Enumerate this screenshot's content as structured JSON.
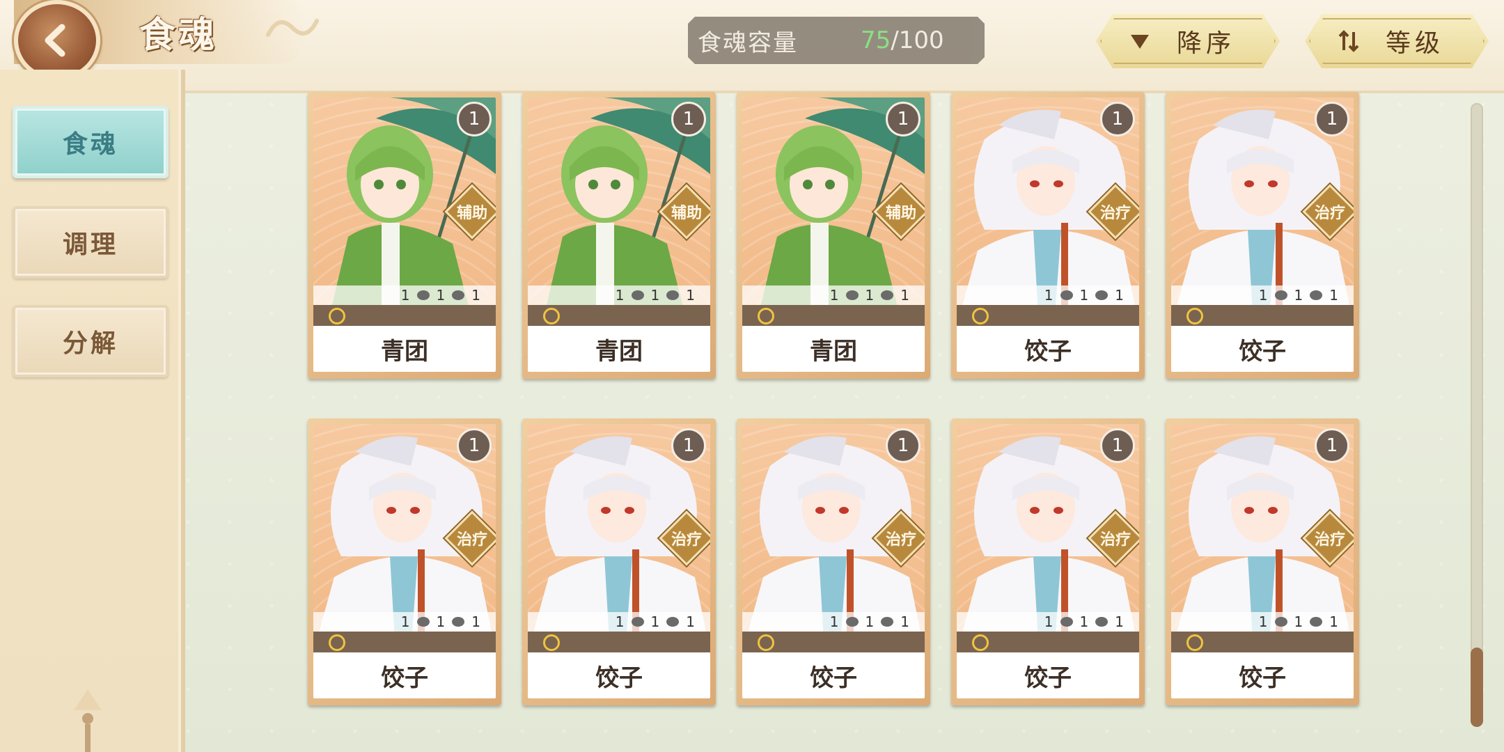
{
  "header": {
    "title": "食魂",
    "capacity_label": "食魂容量",
    "capacity_count": "75",
    "capacity_max": "/100",
    "sort_order_label": "降序",
    "sort_key_label": "等级"
  },
  "sidebar": {
    "items": [
      {
        "label": "食魂",
        "active": true
      },
      {
        "label": "调理",
        "active": false
      },
      {
        "label": "分解",
        "active": false
      }
    ]
  },
  "cards": [
    {
      "name": "青团",
      "level": "1",
      "role": "辅助",
      "stat_a": "1",
      "stat_b": "1",
      "stat_c": "1",
      "character": "qingtuan"
    },
    {
      "name": "青团",
      "level": "1",
      "role": "辅助",
      "stat_a": "1",
      "stat_b": "1",
      "stat_c": "1",
      "character": "qingtuan"
    },
    {
      "name": "青团",
      "level": "1",
      "role": "辅助",
      "stat_a": "1",
      "stat_b": "1",
      "stat_c": "1",
      "character": "qingtuan"
    },
    {
      "name": "饺子",
      "level": "1",
      "role": "治疗",
      "stat_a": "1",
      "stat_b": "1",
      "stat_c": "1",
      "character": "jiaozi"
    },
    {
      "name": "饺子",
      "level": "1",
      "role": "治疗",
      "stat_a": "1",
      "stat_b": "1",
      "stat_c": "1",
      "character": "jiaozi"
    },
    {
      "name": "饺子",
      "level": "1",
      "role": "治疗",
      "stat_a": "1",
      "stat_b": "1",
      "stat_c": "1",
      "character": "jiaozi"
    },
    {
      "name": "饺子",
      "level": "1",
      "role": "治疗",
      "stat_a": "1",
      "stat_b": "1",
      "stat_c": "1",
      "character": "jiaozi"
    },
    {
      "name": "饺子",
      "level": "1",
      "role": "治疗",
      "stat_a": "1",
      "stat_b": "1",
      "stat_c": "1",
      "character": "jiaozi"
    },
    {
      "name": "饺子",
      "level": "1",
      "role": "治疗",
      "stat_a": "1",
      "stat_b": "1",
      "stat_c": "1",
      "character": "jiaozi"
    },
    {
      "name": "饺子",
      "level": "1",
      "role": "治疗",
      "stat_a": "1",
      "stat_b": "1",
      "stat_c": "1",
      "character": "jiaozi"
    }
  ],
  "colors": {
    "capacity_count": "#7fe07a",
    "active_tab": "#8fd0cb",
    "card_frame": "#dcaa74"
  },
  "icons": {
    "back": "chevron-left-icon",
    "sort_order": "triangle-down-icon",
    "sort_key": "swap-vertical-icon"
  }
}
